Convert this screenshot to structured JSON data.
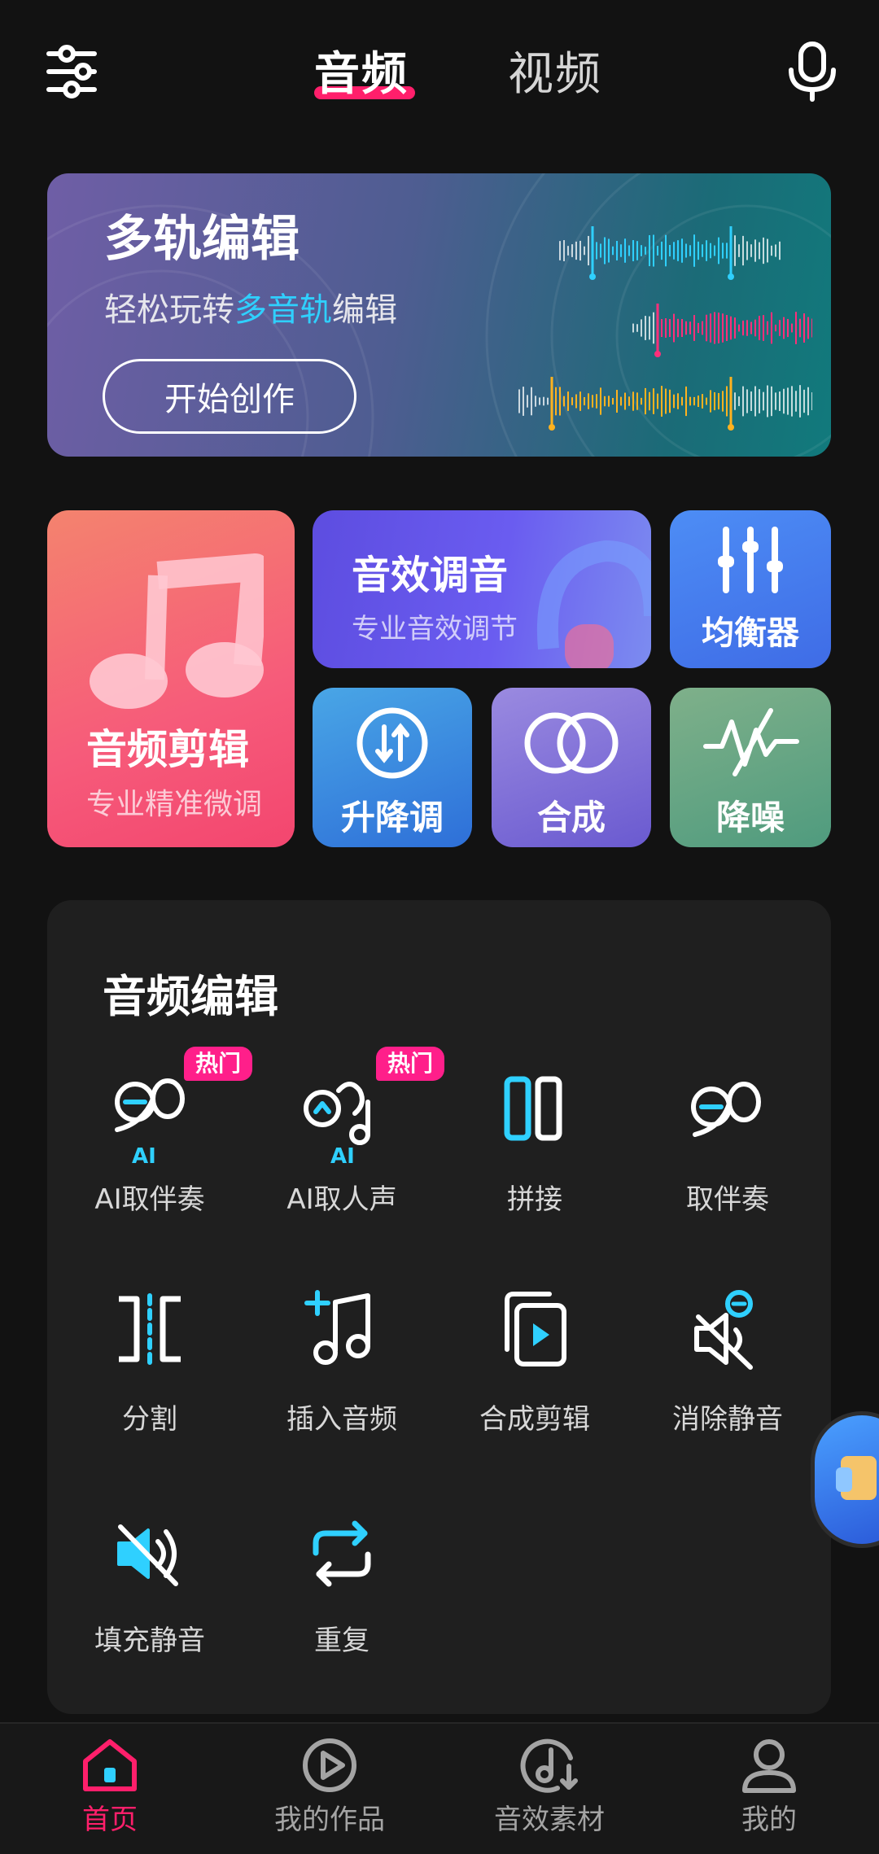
{
  "header": {
    "tabs": [
      {
        "label": "音频",
        "active": true
      },
      {
        "label": "视频",
        "active": false
      }
    ],
    "left_icon": "settings-sliders-icon",
    "right_icon": "microphone-icon"
  },
  "banner": {
    "title": "多轨编辑",
    "subtitle_pre": "轻松玩转",
    "subtitle_highlight": "多音轨",
    "subtitle_post": "编辑",
    "cta": "开始创作"
  },
  "grid": {
    "audio_edit": {
      "label": "音频剪辑",
      "sub": "专业精准微调"
    },
    "sound_effect": {
      "label": "音效调音",
      "sub": "专业音效调节"
    },
    "equalizer": {
      "label": "均衡器"
    },
    "pitch": {
      "label": "升降调"
    },
    "merge": {
      "label": "合成"
    },
    "denoise": {
      "label": "降噪"
    }
  },
  "panel": {
    "title": "音频编辑",
    "hot_badge": "热门",
    "ai_tag": "AI",
    "tools": [
      {
        "label": "AI取伴奏",
        "icon": "ai-microphone-icon"
      },
      {
        "label": "AI取人声",
        "icon": "ai-voice-icon"
      },
      {
        "label": "拼接",
        "icon": "splice-icon"
      },
      {
        "label": "取伴奏",
        "icon": "accompaniment-icon"
      },
      {
        "label": "分割",
        "icon": "split-icon"
      },
      {
        "label": "插入音频",
        "icon": "insert-audio-icon"
      },
      {
        "label": "合成剪辑",
        "icon": "merge-clip-icon"
      },
      {
        "label": "消除静音",
        "icon": "remove-silence-icon"
      },
      {
        "label": "填充静音",
        "icon": "fill-silence-icon"
      },
      {
        "label": "重复",
        "icon": "repeat-icon"
      }
    ]
  },
  "bottom_nav": [
    {
      "label": "首页",
      "icon": "home-icon",
      "active": true
    },
    {
      "label": "我的作品",
      "icon": "play-circle-icon",
      "active": false
    },
    {
      "label": "音效素材",
      "icon": "music-download-icon",
      "active": false
    },
    {
      "label": "我的",
      "icon": "user-icon",
      "active": false
    }
  ],
  "colors": {
    "accent": "#ff1f6b",
    "highlight": "#2fd0ff",
    "background": "#121212",
    "panel": "#1f1f1f"
  }
}
